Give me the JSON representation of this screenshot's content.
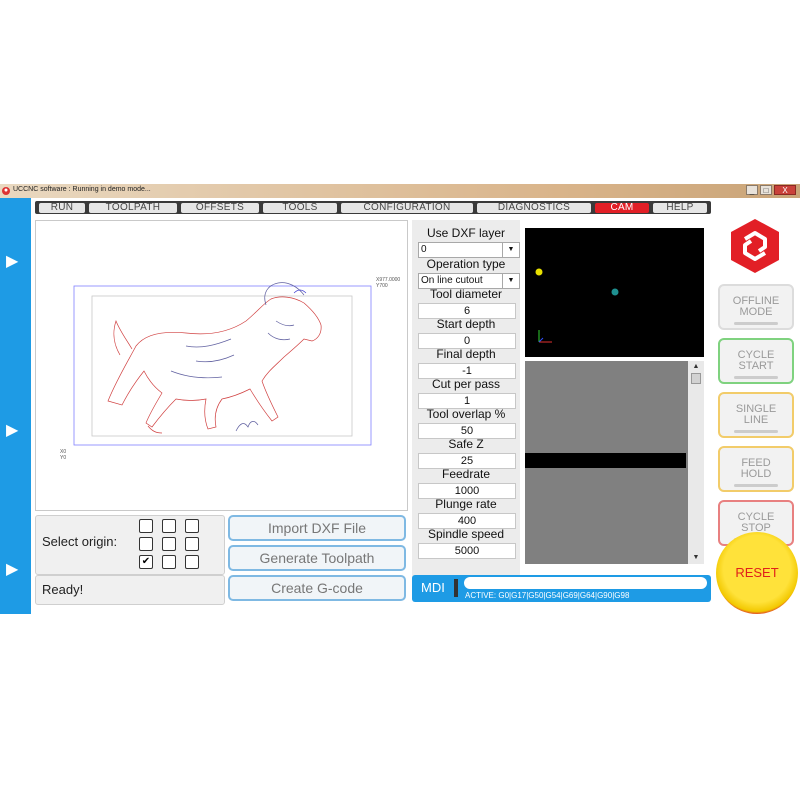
{
  "window": {
    "title": "UCCNC software : Running in demo mode...",
    "controls": [
      "_",
      "□",
      "X"
    ]
  },
  "colors": {
    "accent_blue": "#1e9be5",
    "cam_tab_red": "#e21f26",
    "reset_yellow": "#ffe23a"
  },
  "side_arrows": [
    "▶",
    "▶",
    "▶"
  ],
  "tabs": [
    {
      "label": "RUN",
      "active": false
    },
    {
      "label": "TOOLPATH",
      "active": false
    },
    {
      "label": "OFFSETS",
      "active": false
    },
    {
      "label": "TOOLS",
      "active": false
    },
    {
      "label": "CONFIGURATION",
      "active": false
    },
    {
      "label": "DIAGNOSTICS",
      "active": false
    },
    {
      "label": "CAM",
      "active": true
    },
    {
      "label": "HELP",
      "active": false
    }
  ],
  "preview": {
    "coord_top_right_1": "X977.0000",
    "coord_top_right_2": "Y700",
    "coord_bottom_left_1": "X0",
    "coord_bottom_left_2": "Y0"
  },
  "origin": {
    "label": "Select origin:",
    "checks": [
      "",
      "",
      "",
      "",
      "",
      "",
      "✔",
      "",
      ""
    ]
  },
  "status": {
    "text": "Ready!"
  },
  "buttons": {
    "import": "Import DXF File",
    "generate": "Generate Toolpath",
    "create": "Create G-code"
  },
  "params": {
    "dxf_layer_label": "Use DXF layer",
    "dxf_layer_value": "0",
    "op_type_label": "Operation type",
    "op_type_value": "On line cutout",
    "tool_diameter_label": "Tool diameter",
    "tool_diameter": "6",
    "start_depth_label": "Start depth",
    "start_depth": "0",
    "final_depth_label": "Final depth",
    "final_depth": "-1",
    "cut_per_pass_label": "Cut per pass",
    "cut_per_pass": "1",
    "tool_overlap_label": "Tool overlap %",
    "tool_overlap": "50",
    "safe_z_label": "Safe Z",
    "safe_z": "25",
    "feedrate_label": "Feedrate",
    "feedrate": "1000",
    "plunge_rate_label": "Plunge rate",
    "plunge_rate": "400",
    "spindle_speed_label": "Spindle speed",
    "spindle_speed": "5000",
    "dropdown_arrow": "▼"
  },
  "mdi": {
    "label": "MDI",
    "active_codes": "ACTIVE: G0|G17|G50|G54|G69|G64|G90|G98"
  },
  "side_buttons": {
    "offline": [
      "OFFLINE",
      "MODE"
    ],
    "cycle_start": [
      "CYCLE",
      "START"
    ],
    "single_line": [
      "SINGLE",
      "LINE"
    ],
    "feed_hold": [
      "FEED",
      "HOLD"
    ],
    "cycle_stop": [
      "CYCLE",
      "STOP"
    ],
    "reset": "RESET"
  },
  "scrollbar": {
    "up": "▲",
    "down": "▼"
  }
}
